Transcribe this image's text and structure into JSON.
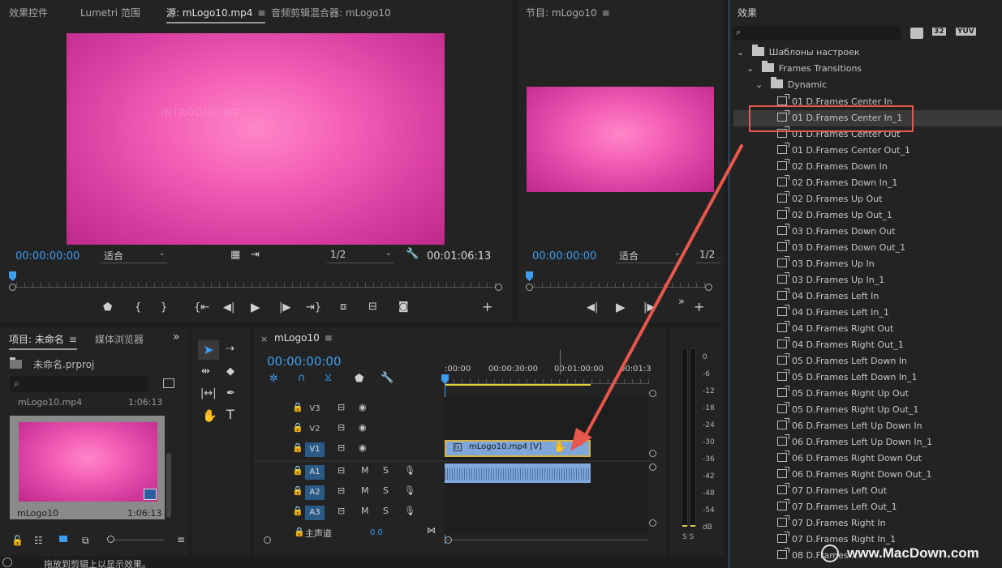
{
  "source_panel": {
    "tabs": [
      "效果控件",
      "Lumetri 范围",
      "源: mLogo10.mp4",
      "音频剪辑混合器: mLogo10"
    ],
    "overlay_text": "INTRODUCING",
    "timecode": "00:00:00:00",
    "fit": "适合",
    "resolution": "1/2",
    "duration": "00:01:06:13"
  },
  "program_panel": {
    "title": "节目: mLogo10",
    "timecode": "00:00:00:00",
    "fit": "适合",
    "resolution": "1/2"
  },
  "effects_panel": {
    "title": "效果",
    "search_placeholder": "",
    "badges": [
      "32",
      "YUV"
    ],
    "tree": {
      "root": "Шаблоны настроек",
      "child": "Frames Transitions",
      "grandchild": "Dynamic"
    },
    "items": [
      "01 D.Frames Center In",
      "01 D.Frames Center In_1",
      "01 D.Frames Center Out",
      "01 D.Frames Center Out_1",
      "02 D.Frames Down In",
      "02 D.Frames Down In_1",
      "02 D.Frames Up Out",
      "02 D.Frames Up Out_1",
      "03 D.Frames Down Out",
      "03 D.Frames Down Out_1",
      "03 D.Frames Up In",
      "03 D.Frames Up In_1",
      "04 D.Frames Left In",
      "04 D.Frames Left In_1",
      "04 D.Frames Right Out",
      "04 D.Frames Right Out_1",
      "05 D.Frames Left Down In",
      "05 D.Frames Left Down In_1",
      "05 D.Frames Right Up Out",
      "05 D.Frames Right Up Out_1",
      "06 D.Frames Left Up Down In",
      "06 D.Frames Left Up Down In_1",
      "06 D.Frames Right Down Out",
      "06 D.Frames Right Down Out_1",
      "07 D.Frames Left Out",
      "07 D.Frames Left Out_1",
      "07 D.Frames Right In",
      "07 D.Frames Right In_1",
      "08 D.Frames ..."
    ],
    "selected_index": 1
  },
  "project_panel": {
    "tabs": [
      "项目: 未命名",
      "媒体浏览器"
    ],
    "file": "未命名.prproj",
    "clip_top_name": "mLogo10.mp4",
    "clip_top_duration": "1:06:13",
    "clip_name": "mLogo10",
    "clip_duration": "1:06:13"
  },
  "timeline": {
    "tab": "mLogo10",
    "timecode": "00:00:00:00",
    "ruler_labels": [
      ":00:00",
      "00:00:30:00",
      "00:01:00:00",
      "00:01:3"
    ],
    "video_tracks": [
      "V3",
      "V2",
      "V1"
    ],
    "audio_tracks": [
      "A1",
      "A2",
      "A3"
    ],
    "master": "主声道",
    "master_value": "0.0",
    "clip_label": "mLogo10.mp4 [V]",
    "audio_btn_m": "M",
    "audio_btn_s": "S"
  },
  "meter": {
    "labels": [
      "0",
      "-6",
      "-12",
      "-18",
      "-24",
      "-30",
      "-36",
      "-42",
      "-48",
      "-54",
      "dB"
    ],
    "footer": "S S"
  },
  "status_bar": "拖放到剪辑上以显示效果。",
  "watermark": "www.MacDown.com",
  "colors": {
    "accent_blue": "#3d9ef0",
    "highlight_red": "#e8574b",
    "clip_blue": "#7fa7d9",
    "pink": "#e651ad"
  }
}
